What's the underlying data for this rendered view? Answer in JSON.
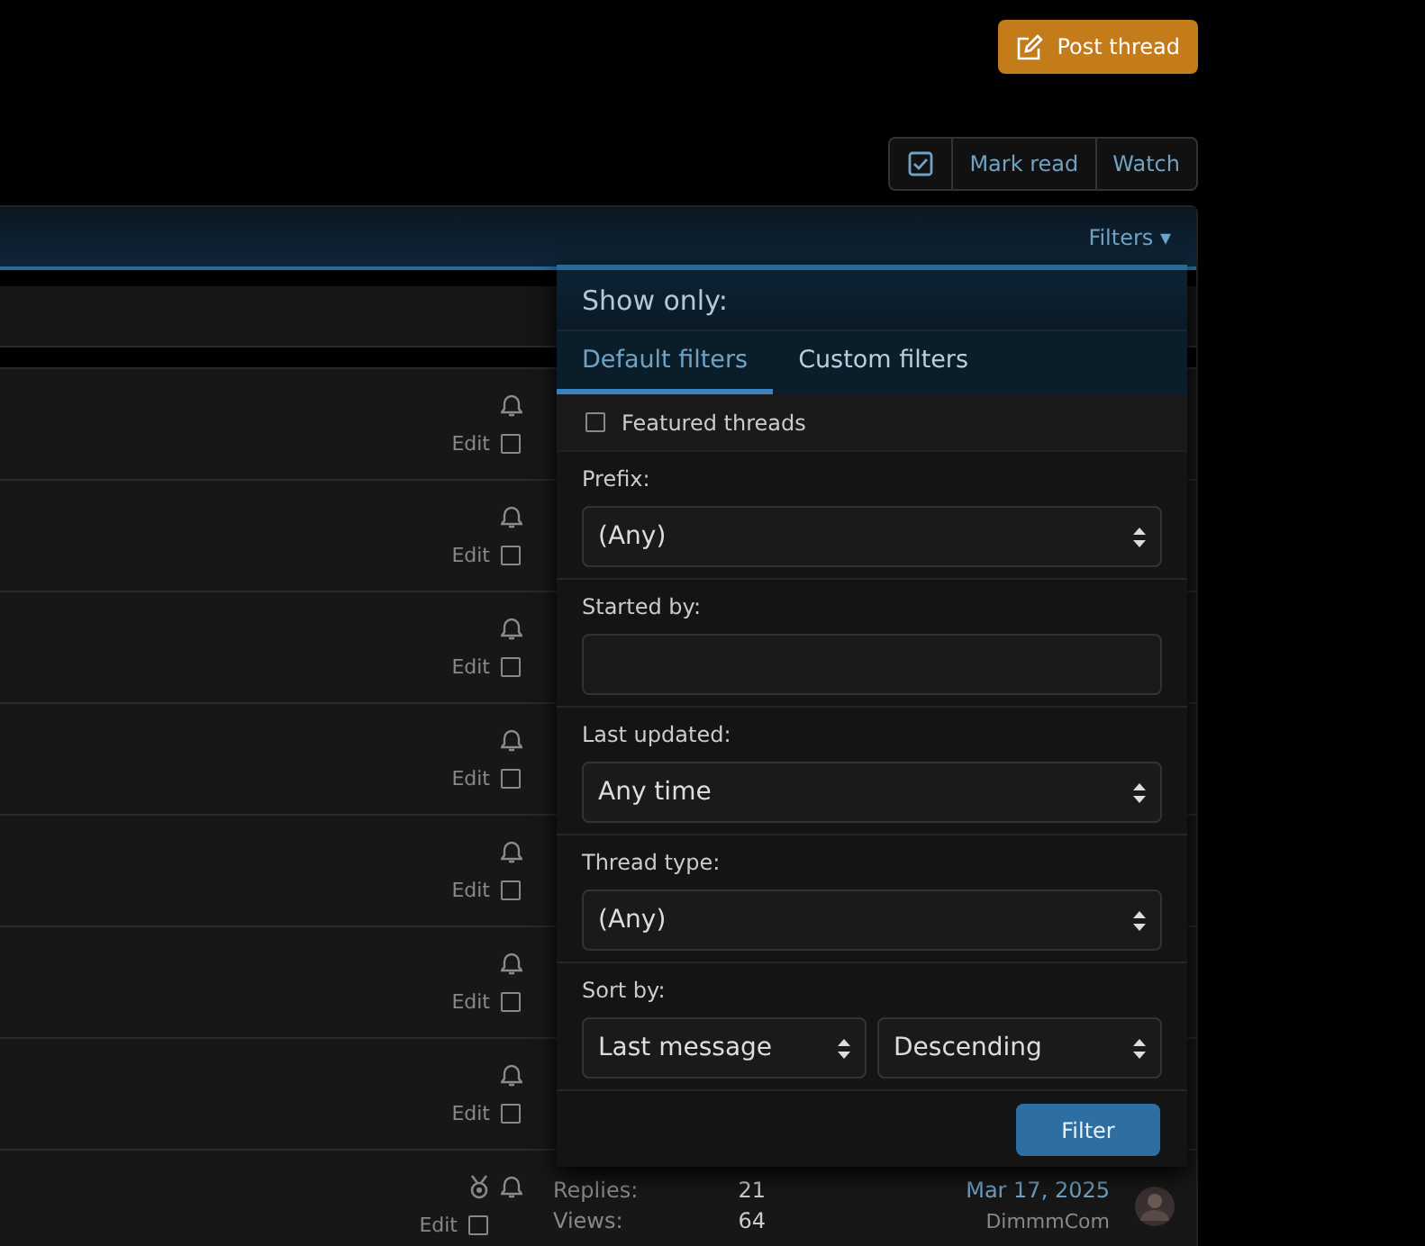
{
  "header": {
    "post_button": "Post thread",
    "toolbar": [
      {
        "kind": "checkbox-icon"
      },
      {
        "kind": "text",
        "label": "Mark read"
      },
      {
        "kind": "text",
        "label": "Watch"
      }
    ]
  },
  "block": {
    "filters_link": "Filters ▾"
  },
  "threads": [
    {
      "edit": "Edit",
      "checked": false,
      "awarded": false
    },
    {
      "edit": "Edit",
      "checked": false,
      "awarded": false
    },
    {
      "edit": "Edit",
      "checked": false,
      "awarded": false
    },
    {
      "edit": "Edit",
      "checked": false,
      "awarded": false
    },
    {
      "edit": "Edit",
      "checked": false,
      "awarded": false
    },
    {
      "edit": "Edit",
      "checked": false,
      "awarded": false
    },
    {
      "edit": "Edit",
      "checked": false,
      "awarded": false
    },
    {
      "edit": "Edit",
      "checked": false,
      "awarded": true,
      "replies_label": "Replies:",
      "replies": "21",
      "views_label": "Views:",
      "views": "64",
      "date": "Mar 17, 2025",
      "last_poster": "DimmmCom"
    }
  ],
  "filter_menu": {
    "title": "Show only:",
    "tabs": [
      {
        "label": "Default filters",
        "selected": true
      },
      {
        "label": "Custom filters",
        "selected": false
      }
    ],
    "featured": {
      "label": "Featured threads",
      "checked": false
    },
    "fields": [
      {
        "kind": "select",
        "label": "Prefix:",
        "value": "(Any)"
      },
      {
        "kind": "text",
        "label": "Started by:"
      },
      {
        "kind": "select",
        "label": "Last updated:",
        "value": "Any time"
      },
      {
        "kind": "select",
        "label": "Thread type:",
        "value": "(Any)"
      },
      {
        "kind": "pair",
        "label": "Sort by:",
        "values": [
          "Last message",
          "Descending"
        ]
      }
    ],
    "submit": "Filter"
  }
}
